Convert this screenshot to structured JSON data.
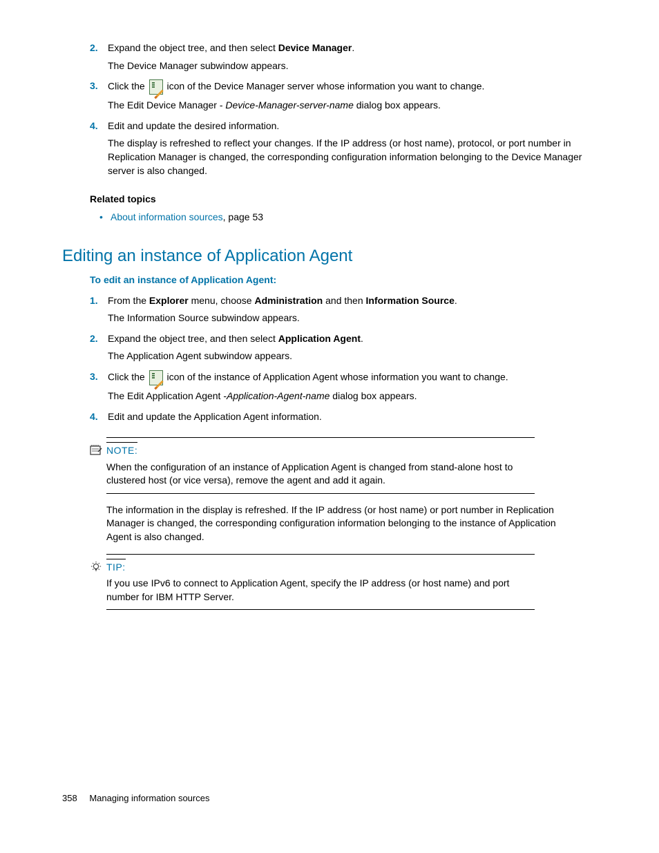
{
  "section1": {
    "steps": [
      {
        "num": "2.",
        "line1_a": "Expand the object tree, and then select ",
        "line1_bold": "Device Manager",
        "line1_b": ".",
        "line2": "The Device Manager subwindow appears."
      },
      {
        "num": "3.",
        "line1_a": "Click the ",
        "line1_b": " icon of the Device Manager server whose information you want to change.",
        "line2_a": "The Edit Device Manager - ",
        "line2_italic": "Device-Manager-server-name",
        "line2_b": " dialog box appears."
      },
      {
        "num": "4.",
        "line1": "Edit and update the desired information.",
        "line2": "The display is refreshed to reflect your changes. If the IP address (or host name), protocol, or port number in Replication Manager is changed, the corresponding configuration information belonging to the Device Manager server is also changed."
      }
    ],
    "related_heading": "Related topics",
    "related_link": "About information sources",
    "related_suffix": ", page 53"
  },
  "heading": "Editing an instance of Application Agent",
  "subheading": "To edit an instance of Application Agent:",
  "section2": {
    "steps": [
      {
        "num": "1.",
        "line1_a": "From the ",
        "line1_b1": "Explorer",
        "line1_c": " menu, choose ",
        "line1_b2": "Administration",
        "line1_d": " and then ",
        "line1_b3": "Information Source",
        "line1_e": ".",
        "line2": "The Information Source subwindow appears."
      },
      {
        "num": "2.",
        "line1_a": "Expand the object tree, and then select ",
        "line1_bold": "Application Agent",
        "line1_b": ".",
        "line2": "The Application Agent subwindow appears."
      },
      {
        "num": "3.",
        "line1_a": "Click the ",
        "line1_b": " icon of the instance of Application Agent whose information you want to change.",
        "line2_a": "The Edit Application Agent -",
        "line2_italic": "Application-Agent-name",
        "line2_b": " dialog box appears."
      },
      {
        "num": "4.",
        "line1": "Edit and update the Application Agent information."
      }
    ]
  },
  "note": {
    "label": "NOTE:",
    "body": "When the configuration of an instance of Application Agent is changed from stand-alone host to clustered host (or vice versa), remove the agent and add it again."
  },
  "mid_para": "The information in the display is refreshed. If the IP address (or host name) or port number in Replication Manager is changed, the corresponding configuration information belonging to the instance of Application Agent is also changed.",
  "tip": {
    "label": "TIP:",
    "body": "If you use IPv6 to connect to Application Agent, specify the IP address (or host name) and port number for IBM HTTP Server."
  },
  "footer": {
    "page": "358",
    "title": "Managing information sources"
  }
}
